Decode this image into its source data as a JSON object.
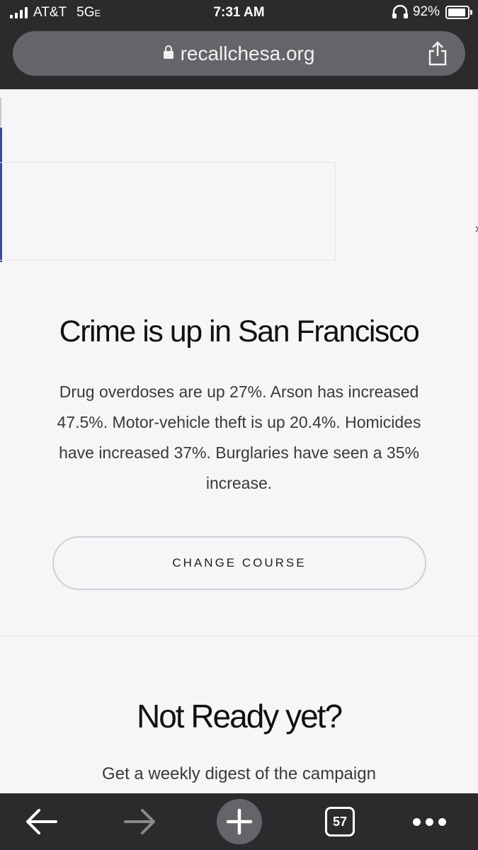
{
  "status_bar": {
    "carrier": "AT&T",
    "network": "5G",
    "network_sub": "E",
    "time": "7:31 AM",
    "battery_percent": "92%",
    "battery_level": 0.92,
    "icons": [
      "signal-bars-icon",
      "headphones-icon",
      "battery-icon"
    ]
  },
  "browser": {
    "url": "recallchesa.org",
    "tab_count": "57",
    "icons": [
      "lock-icon",
      "share-icon",
      "back-arrow-icon",
      "forward-arrow-icon",
      "new-tab-plus-icon",
      "more-dots-icon"
    ]
  },
  "hero": {
    "title": "Crime is up in San Francisco",
    "body": "Drug overdoses are up 27%. Arson has increased 47.5%. Motor-vehicle theft is up 20.4%. Homicides have increased 37%. Burglaries have seen a 35% increase.",
    "button_label": "CHANGE COURSE"
  },
  "newsletter": {
    "title": "Not Ready yet?",
    "subtitle": "Get a weekly digest of the campaign"
  },
  "colors": {
    "chrome": "#2b2b2d",
    "url_bar": "#646568",
    "page_bg": "#f6f6f9",
    "accent": "#3b4a9c"
  }
}
